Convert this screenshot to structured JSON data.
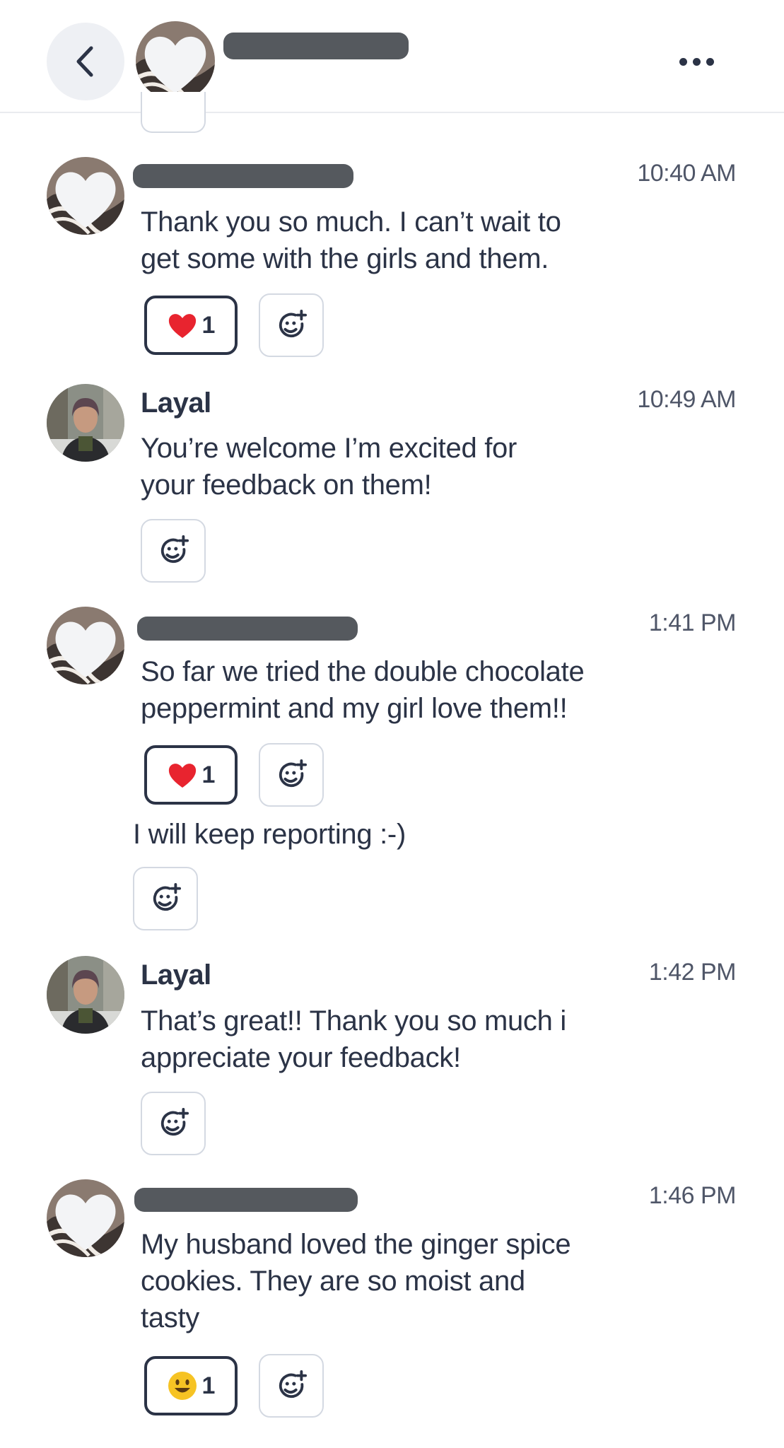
{
  "header": {
    "back_icon": "chevron-left-icon",
    "more_icon": "more-horizontal-icon"
  },
  "messages": [
    {
      "sender": "",
      "time": "10:40 AM",
      "text": "Thank you so much. I can’t wait to\nget some with the girls and them.",
      "reaction": {
        "emoji": "heart",
        "count": "1"
      }
    },
    {
      "sender": "Layal",
      "time": "10:49 AM",
      "text": "You’re welcome I’m excited for\nyour feedback on them!"
    },
    {
      "sender": "",
      "time": "1:41 PM",
      "text": "So far we tried the double chocolate\npeppermint and my girl love them!!",
      "reaction": {
        "emoji": "heart",
        "count": "1"
      }
    },
    {
      "text": "I will keep reporting :-)"
    },
    {
      "sender": "Layal",
      "time": "1:42 PM",
      "text": "That’s great!! Thank you so much i\nappreciate your feedback!"
    },
    {
      "sender": "",
      "time": "1:46 PM",
      "text": "My husband loved the ginger spice\ncookies. They are so moist and\ntasty",
      "reaction": {
        "emoji": "smiley",
        "count": "1"
      }
    }
  ],
  "colors": {
    "text": "#2b3346",
    "border": "#d4d9e2",
    "back_bg": "#eef0f4",
    "redaction": "#55595e"
  }
}
